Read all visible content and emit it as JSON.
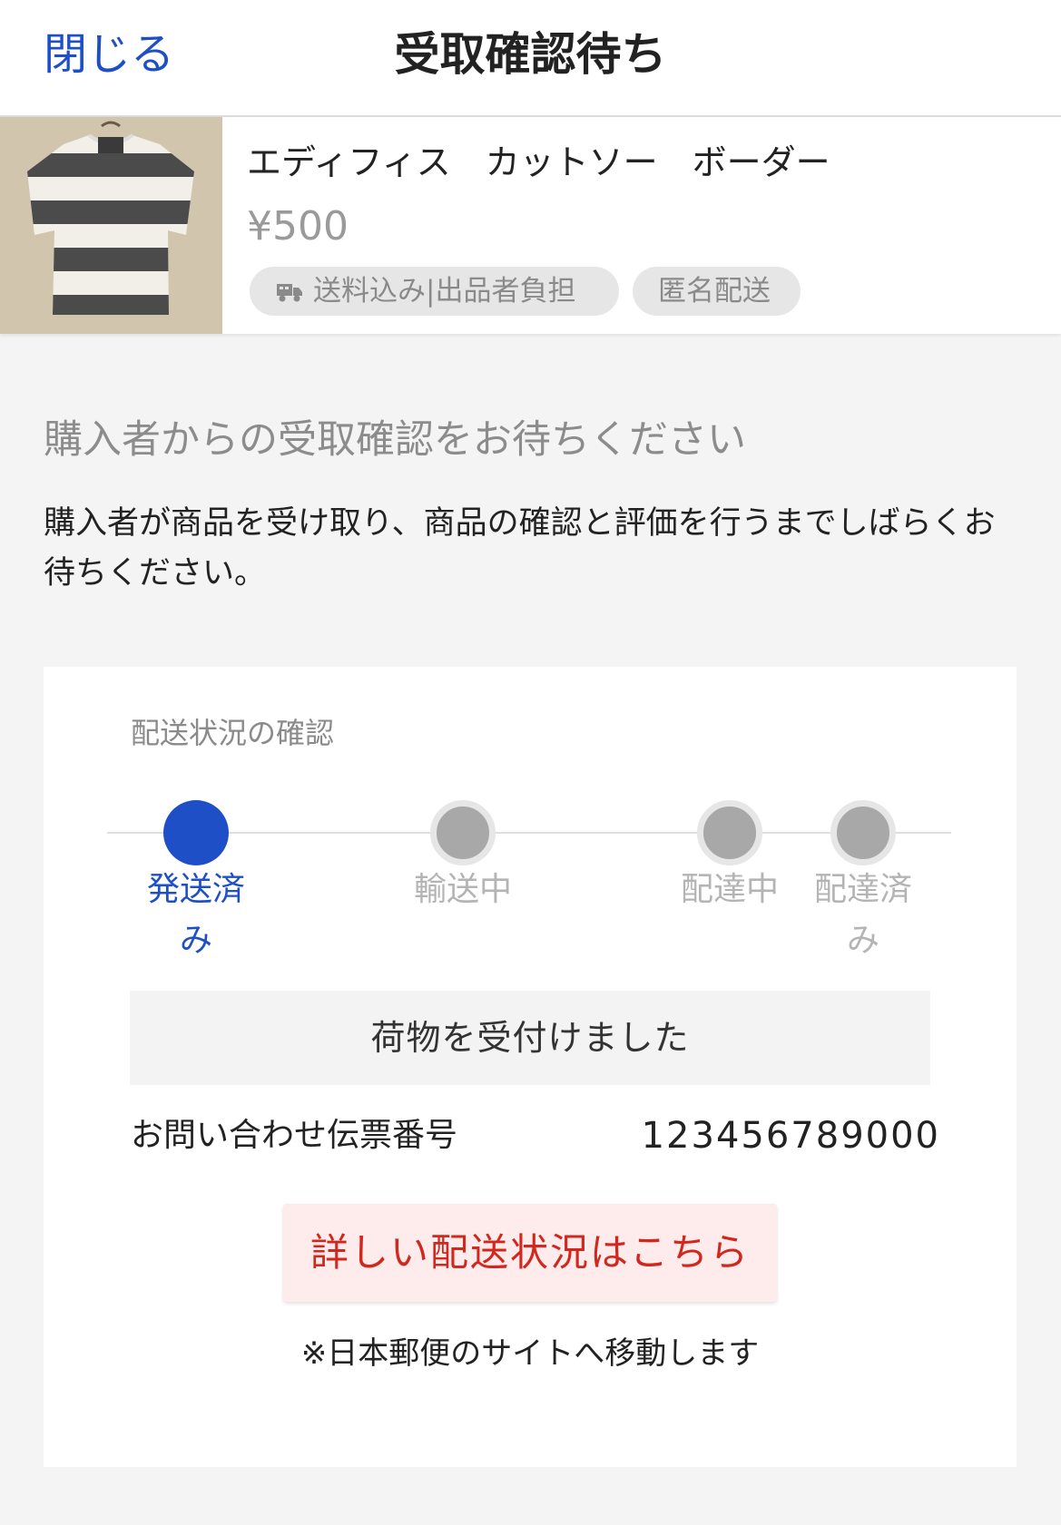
{
  "header": {
    "close_label": "閉じる",
    "title": "受取確認待ち"
  },
  "product": {
    "name": "エディフィス　カットソー　ボーダー",
    "price": "¥500",
    "tags": {
      "shipping": "送料込み|出品者負担",
      "anonymous": "匿名配送"
    },
    "image_icon": "striped-shirt-photo",
    "shipping_icon": "truck-icon"
  },
  "status": {
    "title": "購入者からの受取確認をお待ちください",
    "description": "購入者が商品を受け取り、商品の確認と評価を行うまでしばらくお待ちください。"
  },
  "delivery": {
    "heading": "配送状況の確認",
    "steps": [
      {
        "label": "発送済み",
        "state": "active"
      },
      {
        "label": "輸送中",
        "state": "pending"
      },
      {
        "label": "配達中",
        "state": "pending"
      },
      {
        "label": "配達済み",
        "state": "pending"
      }
    ],
    "message": "荷物を受付けました",
    "tracking_label": "お問い合わせ伝票番号",
    "tracking_number": "123456789000",
    "detail_button": "詳しい配送状況はこちら",
    "redirect_note": "※日本郵便のサイトへ移動します"
  },
  "colors": {
    "accent_blue": "#1f4fc7",
    "detail_red": "#d0281e",
    "detail_bg": "#fdeceb",
    "page_bg": "#f4f4f4"
  }
}
